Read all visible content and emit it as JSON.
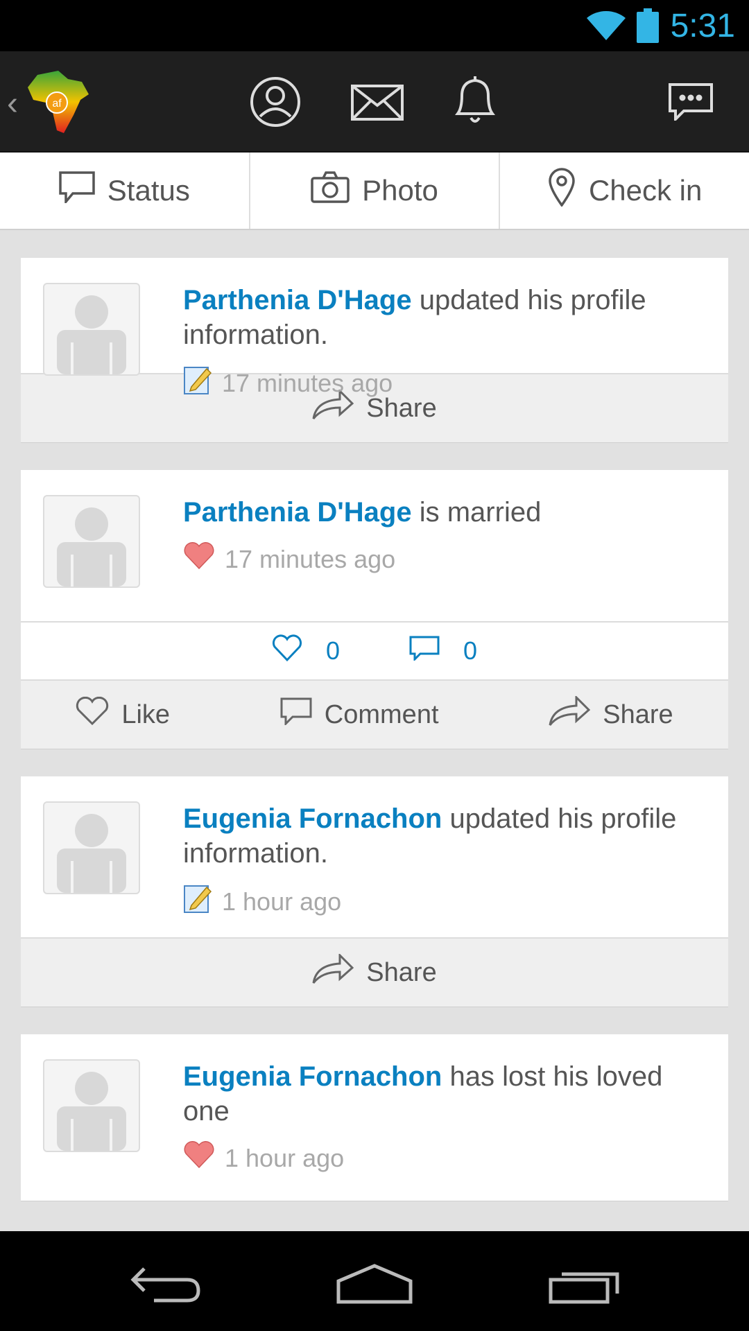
{
  "status_bar": {
    "time": "5:31",
    "icons": [
      "wifi-icon",
      "battery-icon"
    ]
  },
  "action_bar": {
    "icons": [
      "back-chevron-icon",
      "app-logo",
      "profile-icon",
      "mail-icon",
      "bell-icon",
      "chat-icon"
    ],
    "logo_text": "af"
  },
  "tabs": [
    {
      "label": "Status",
      "icon": "speech-bubble-icon"
    },
    {
      "label": "Photo",
      "icon": "camera-icon"
    },
    {
      "label": "Check in",
      "icon": "map-pin-icon"
    }
  ],
  "feed": [
    {
      "name": "Parthenia D'Hage",
      "text": "updated his profile information.",
      "meta_icon": "edit-note-icon",
      "time": "17 minutes ago",
      "share_label": "Share"
    },
    {
      "name": "Parthenia D'Hage",
      "text": "is married",
      "meta_icon": "heart-icon",
      "time": "17 minutes ago",
      "likes": "0",
      "comments": "0",
      "like_label": "Like",
      "comment_label": "Comment",
      "share_label": "Share"
    },
    {
      "name": "Eugenia Fornachon",
      "text": "updated his profile information.",
      "meta_icon": "edit-note-icon",
      "time": "1 hour ago",
      "share_label": "Share"
    },
    {
      "name": "Eugenia Fornachon",
      "text": "has lost his loved one",
      "meta_icon": "heart-icon",
      "time": "1 hour ago"
    }
  ],
  "nav_bar": {
    "icons": [
      "back-icon",
      "home-icon",
      "recents-icon"
    ]
  },
  "colors": {
    "accent": "#0a80c0",
    "status": "#33b5e5",
    "action_bar": "#1f1f1f"
  }
}
